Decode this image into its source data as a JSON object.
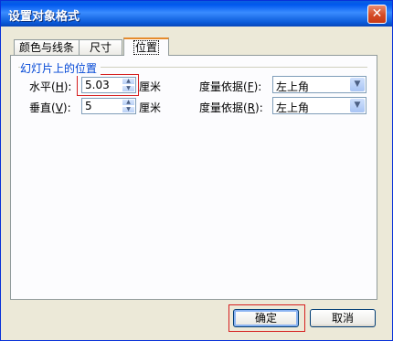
{
  "dialog": {
    "title": "设置对象格式",
    "close_symbol": "✕"
  },
  "tabs": [
    {
      "label": "颜色与线条",
      "active": false
    },
    {
      "label": "尺寸",
      "active": false
    },
    {
      "label": "位置",
      "active": true
    }
  ],
  "position_group": {
    "title": "幻灯片上的位置",
    "horizontal": {
      "label": "水平",
      "key": "H",
      "value": "5.03",
      "unit": "厘米",
      "measure_label": "度量依据",
      "measure_key": "F",
      "measure_value": "左上角"
    },
    "vertical": {
      "label": "垂直",
      "key": "V",
      "value": "5",
      "unit": "厘米",
      "measure_label": "度量依据",
      "measure_key": "R",
      "measure_value": "左上角"
    }
  },
  "buttons": {
    "ok": "确定",
    "cancel": "取消"
  },
  "colors": {
    "titlebar": "#0058ee",
    "highlight": "#d62020",
    "group_title": "#0046d5"
  }
}
